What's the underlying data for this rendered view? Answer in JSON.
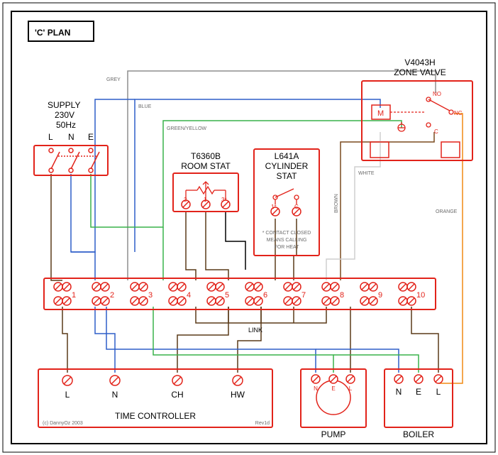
{
  "diagram": {
    "title": "'C' PLAN",
    "supply": {
      "label": "SUPPLY",
      "voltage": "230V",
      "hz": "50Hz",
      "L": "L",
      "N": "N",
      "E": "E"
    },
    "roomstat": {
      "model": "T6360B",
      "label": "ROOM STAT",
      "t1": "2",
      "t2": "1",
      "t3": "3*"
    },
    "cylstat": {
      "model": "L641A",
      "label1": "CYLINDER",
      "label2": "STAT",
      "t1": "1*",
      "t2": "C",
      "note1": "* CONTACT CLOSED",
      "note2": "MEANS CALLING",
      "note3": "FOR HEAT"
    },
    "zone": {
      "model": "V4043H",
      "label": "ZONE VALVE",
      "M": "M",
      "NO": "NO",
      "NC": "NC",
      "C": "C"
    },
    "junction": {
      "link": "LINK",
      "t1": "1",
      "t2": "2",
      "t3": "3",
      "t4": "4",
      "t5": "5",
      "t6": "6",
      "t7": "7",
      "t8": "8",
      "t9": "9",
      "t10": "10"
    },
    "timer": {
      "label": "TIME CONTROLLER",
      "L": "L",
      "N": "N",
      "CH": "CH",
      "HW": "HW"
    },
    "pump": {
      "label": "PUMP",
      "N": "N",
      "E": "E",
      "L": "L"
    },
    "boiler": {
      "label": "BOILER",
      "N": "N",
      "E": "E",
      "L": "L"
    },
    "wires": {
      "grey": "GREY",
      "blue": "BLUE",
      "gy": "GREEN/YELLOW",
      "brown": "BROWN",
      "white": "WHITE",
      "orange": "ORANGE"
    },
    "meta": {
      "copyright": "(c) DannyOz 2003",
      "rev": "Rev1d"
    }
  }
}
